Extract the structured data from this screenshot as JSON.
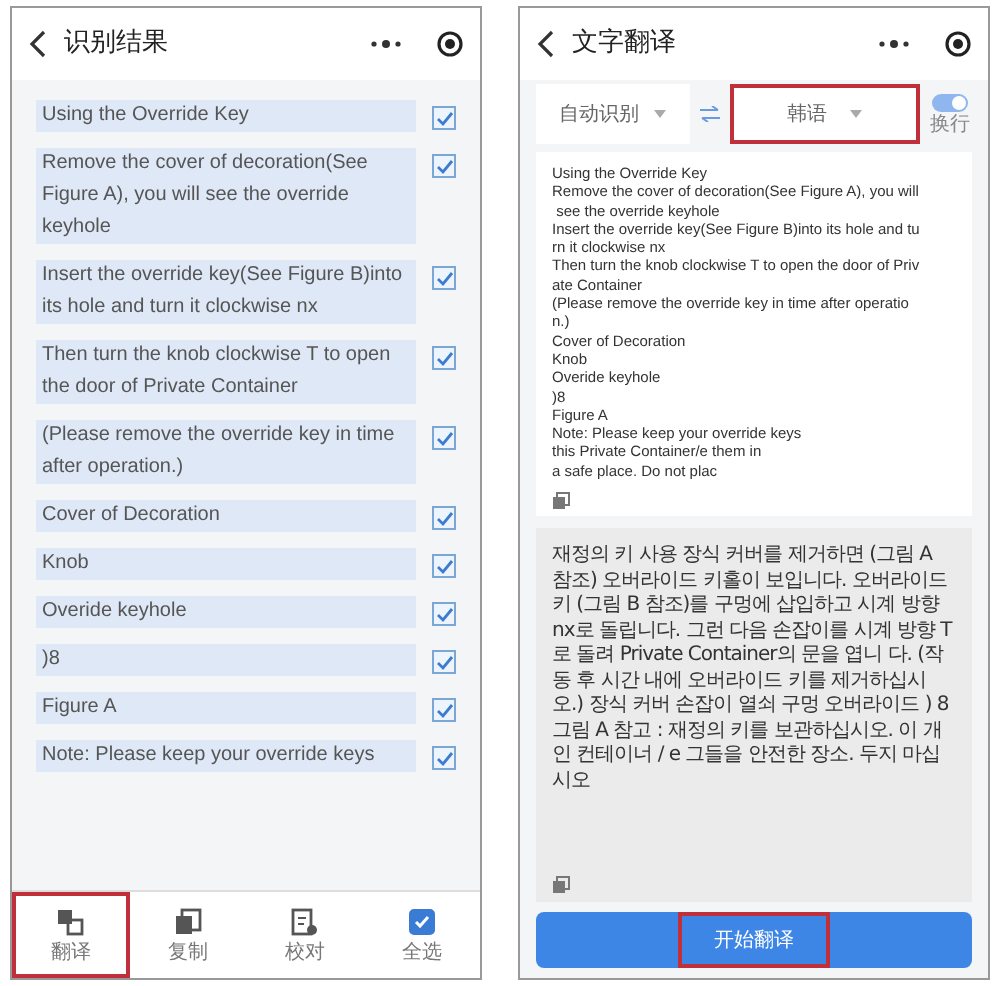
{
  "left_screen": {
    "title": "识别结果",
    "items": [
      {
        "text": "Using the Override Key",
        "checked": true
      },
      {
        "text": "Remove the cover of decoration(See Figure A), you will see the override keyhole",
        "checked": true
      },
      {
        "text": "Insert the override key(See Figure B)into its hole and turn it clockwise nx",
        "checked": true
      },
      {
        "text": "Then turn the knob clockwise T to open the door of Private Container",
        "checked": true
      },
      {
        "text": "(Please remove the override key in time after operation.)",
        "checked": true
      },
      {
        "text": "Cover of Decoration",
        "checked": true
      },
      {
        "text": "Knob",
        "checked": true
      },
      {
        "text": "Overide keyhole",
        "checked": true
      },
      {
        "text": ")8",
        "checked": true
      },
      {
        "text": "Figure A",
        "checked": true
      },
      {
        "text": "Note: Please keep your override keys",
        "checked": true
      }
    ],
    "toolbar": [
      {
        "label": "翻译",
        "kind": "translate",
        "annotated": true
      },
      {
        "label": "复制",
        "kind": "copy",
        "annotated": false
      },
      {
        "label": "校对",
        "kind": "proofread",
        "annotated": false
      },
      {
        "label": "全选",
        "kind": "select_all",
        "annotated": false,
        "checked": true
      }
    ]
  },
  "right_screen": {
    "title": "文字翻译",
    "source_language": {
      "label": "自动识别",
      "annotated": false
    },
    "target_language": {
      "label": "韩语",
      "annotated": true
    },
    "wrap_toggle": {
      "label": "换行",
      "on": true
    },
    "source_lines": [
      "Using the Override Key",
      "Remove the cover of decoration(See Figure A), you will",
      " see the override keyhole",
      "Insert the override key(See Figure B)into its hole and tu",
      "rn it clockwise nx",
      "Then turn the knob clockwise T to open the door of Priv",
      "ate Container",
      "(Please remove the override key in time after operatio",
      "n.)",
      "Cover of Decoration",
      "Knob",
      "Overide keyhole",
      ")8",
      "Figure A",
      "Note: Please keep your override keys",
      "this Private Container/e them in",
      "a safe place. Do not plac"
    ],
    "translation": "재정의 키 사용 장식 커버를 제거하면 (그림 A 참조) 오버라이드 키홀이 보입니다. 오버라이드 키 (그림 B 참조)를 구멍에 삽입하고 시계 방향 nx로 돌립니다. 그런 다음 손잡이를 시계 방향 T로 돌려 Private Container의 문을 엽니 다. (작동 후 시간 내에 오버라이드 키를 제거하십시오.) 장식 커버 손잡이 열쇠 구멍 오버라이드 ) 8 그림 A 참고 : 재정의 키를 보관하십시오. 이 개인 컨테이너 / e 그들을 안전한 장소. 두지 마십시오",
    "start_button": {
      "label": "开始翻译",
      "annotated": true
    }
  }
}
